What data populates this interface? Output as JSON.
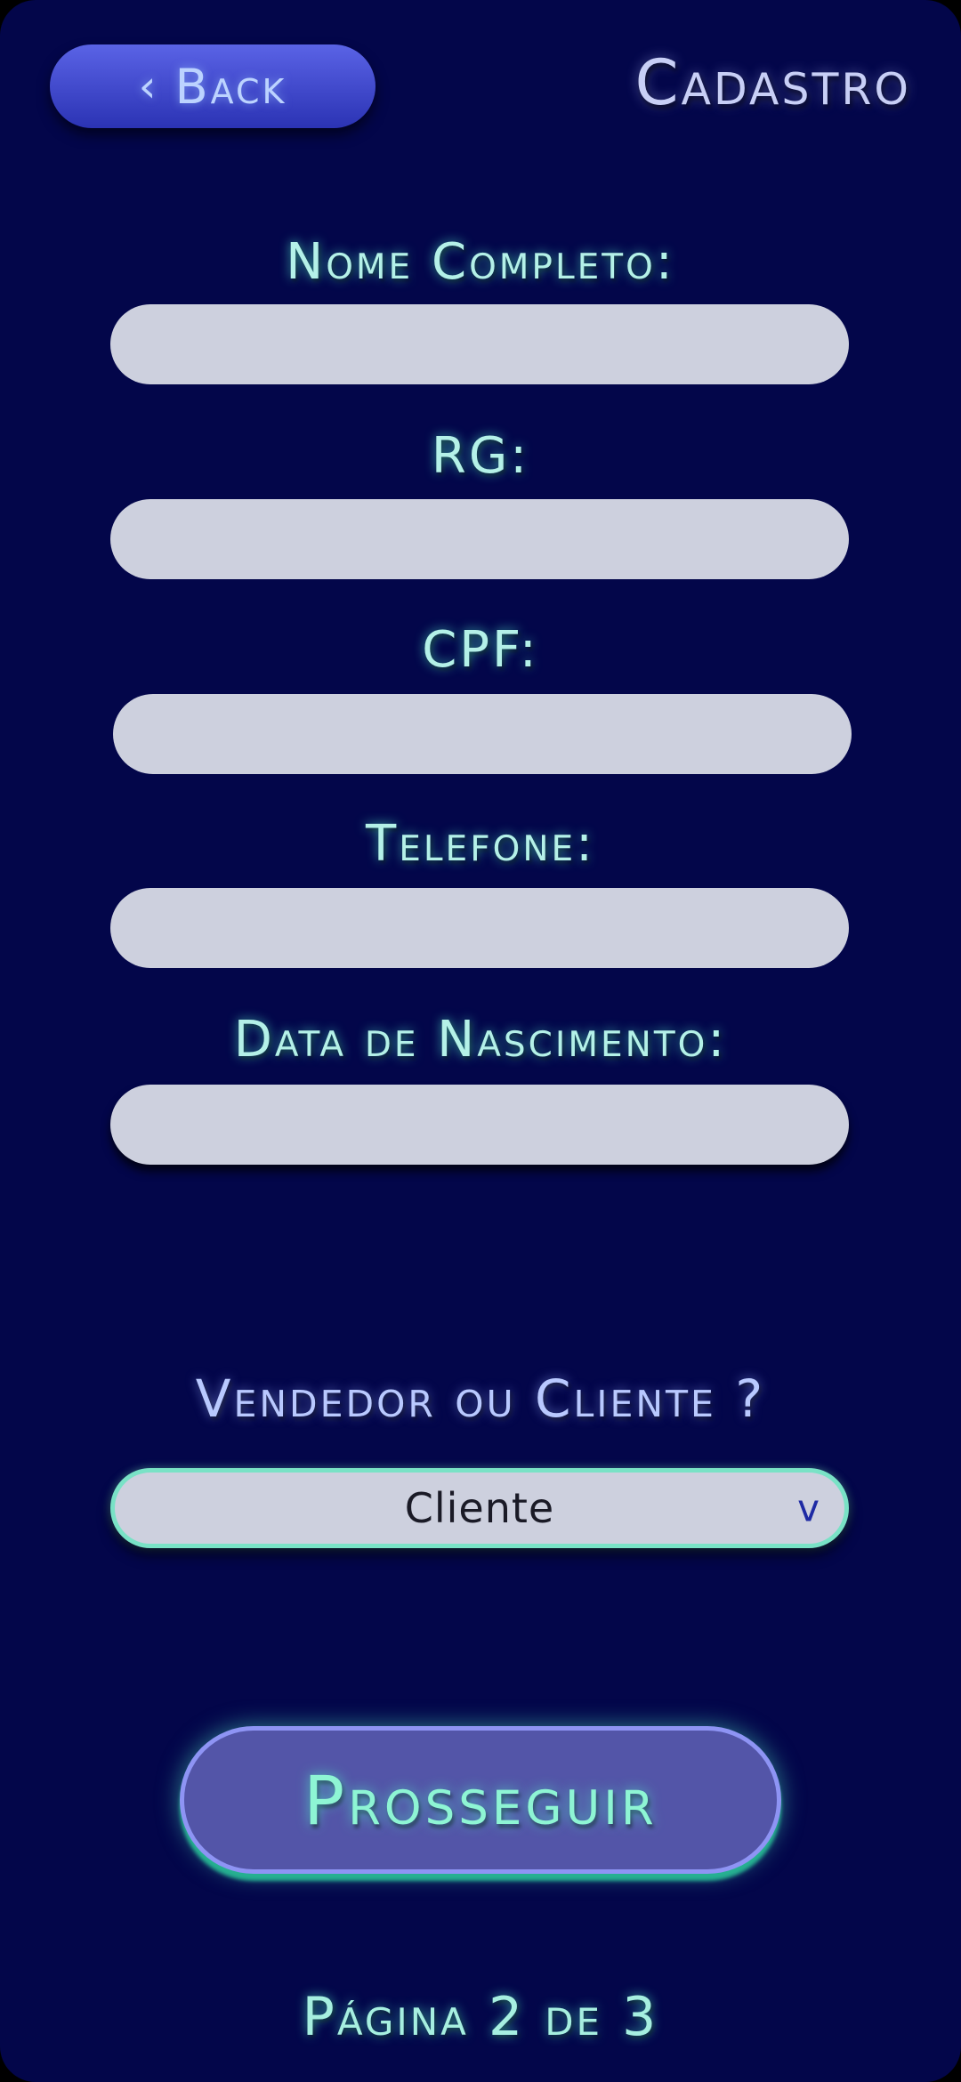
{
  "header": {
    "back_label": "Back",
    "back_icon": "chevron-left-icon",
    "title": "Cadastro"
  },
  "form": {
    "fields": [
      {
        "label": "Nome Completo:",
        "value": "",
        "placeholder": ""
      },
      {
        "label": "RG:",
        "value": "",
        "placeholder": ""
      },
      {
        "label": "CPF:",
        "value": "",
        "placeholder": ""
      },
      {
        "label": "Telefone:",
        "value": "",
        "placeholder": ""
      },
      {
        "label": "Data de Nascimento:",
        "value": "",
        "placeholder": ""
      }
    ],
    "role": {
      "label": "Vendedor ou Cliente ?",
      "selected": "Cliente",
      "arrow_glyph": "v"
    },
    "proceed_label": "Prosseguir"
  },
  "footer": {
    "page_indicator": "Página 2 de 3"
  },
  "colors": {
    "background": "#03064a",
    "accent_teal": "#79e2c6",
    "input_fill": "#cdd0de",
    "button_fill": "#5355a8"
  }
}
